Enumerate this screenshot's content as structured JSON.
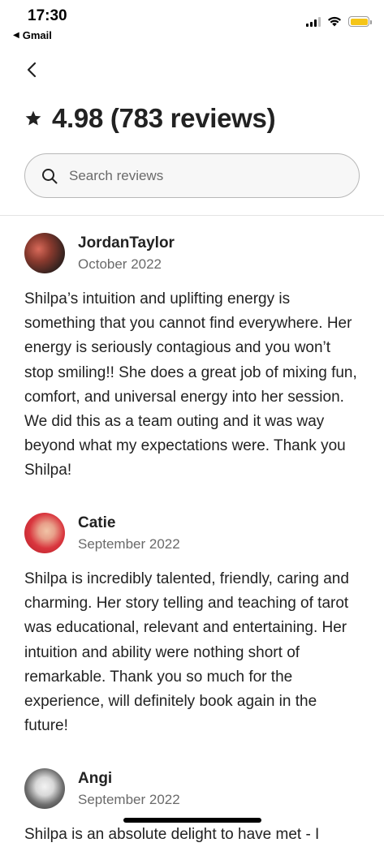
{
  "status_bar": {
    "time": "17:30",
    "back_app_label": "Gmail",
    "battery_color": "#f5c518"
  },
  "header": {
    "back_icon": "chevron-left-icon",
    "star_icon": "star-icon",
    "rating_title": "4.98 (783 reviews)"
  },
  "search": {
    "placeholder": "Search reviews",
    "value": "",
    "icon": "search-icon"
  },
  "reviews": [
    {
      "name": "JordanTaylor",
      "date": "October 2022",
      "text": "Shilpa’s intuition and uplifting energy is something that you cannot find everywhere. Her energy is seriously contagious and you won’t stop smiling!! She does a great job of mixing fun, comfort, and universal energy into her session. We did this as a team outing and it was way beyond what my expectations were. Thank you Shilpa!"
    },
    {
      "name": "Catie",
      "date": "September 2022",
      "text": "Shilpa is incredibly talented, friendly, caring and charming. Her story telling and teaching of tarot was educational, relevant and entertaining. Her intuition and ability were nothing short of remarkable. Thank you so much for the experience, will definitely book again in the future!"
    },
    {
      "name": "Angi",
      "date": "September 2022",
      "text": "Shilpa is an absolute delight to have met - I"
    }
  ]
}
